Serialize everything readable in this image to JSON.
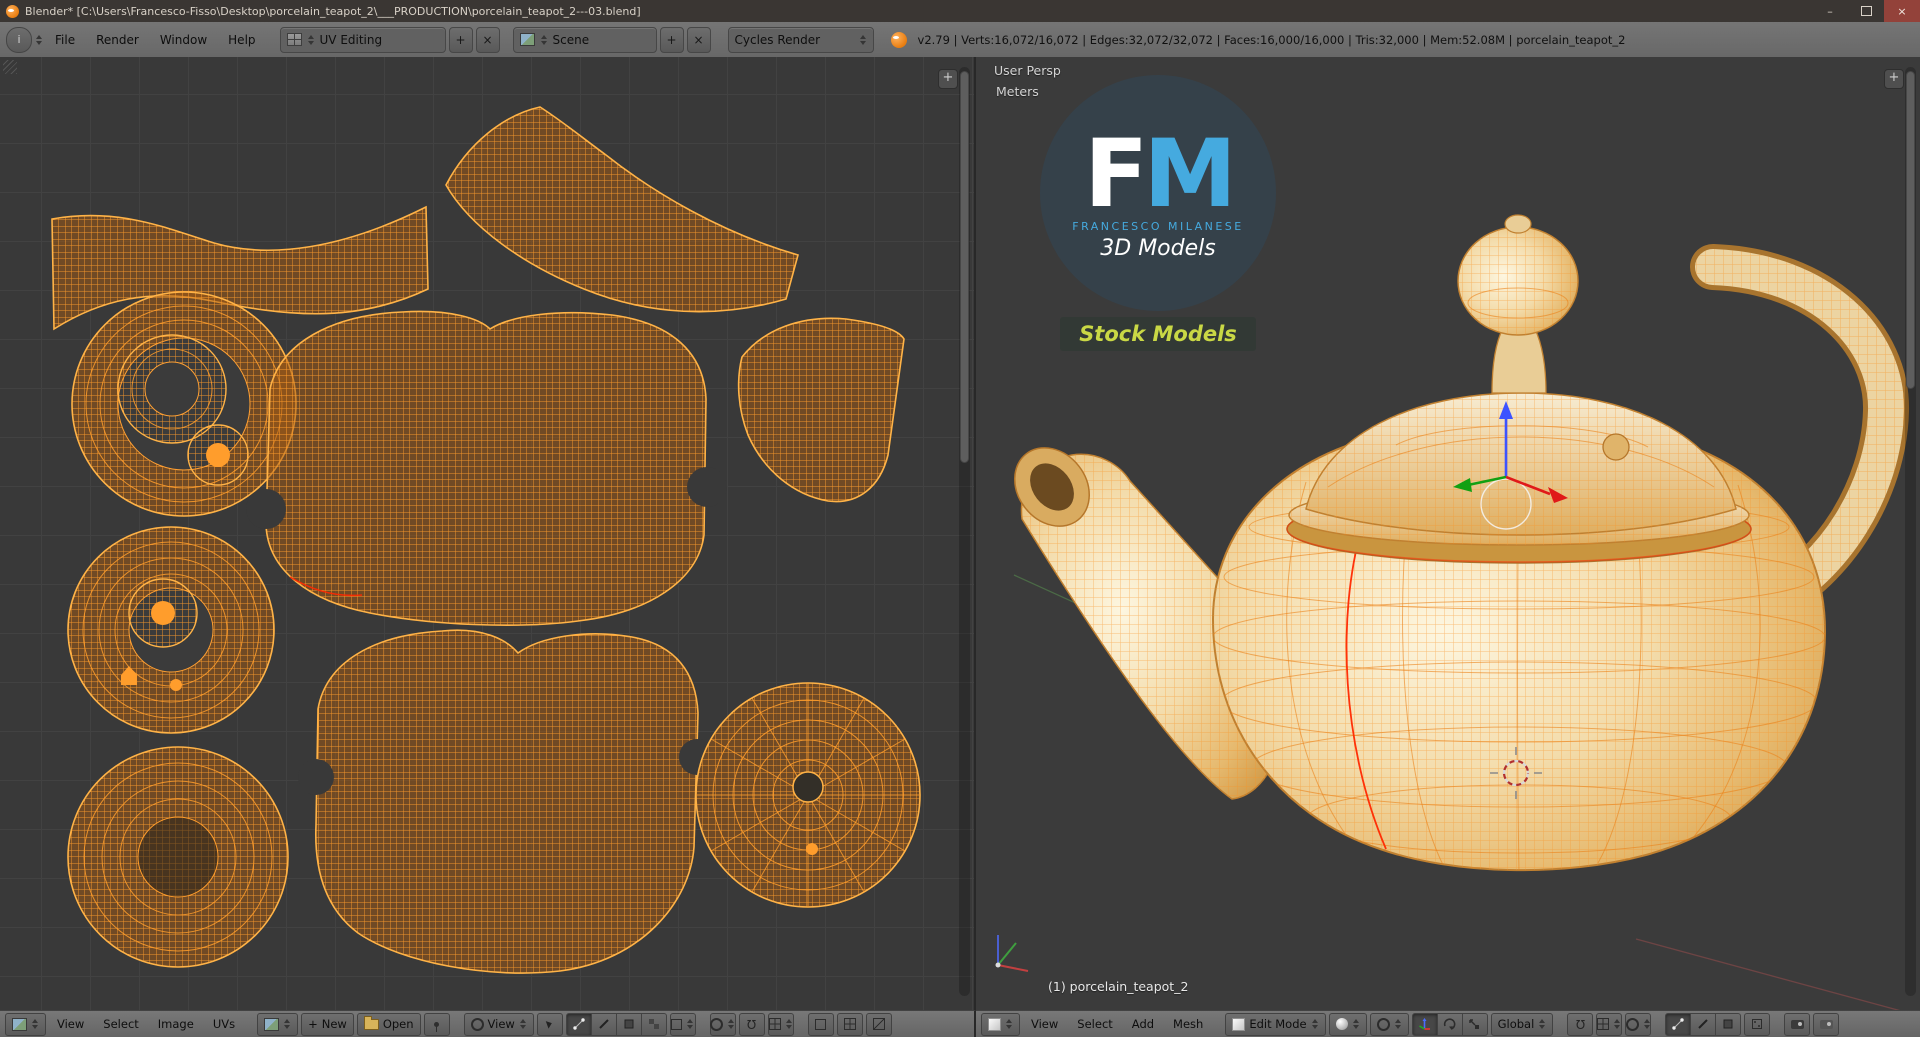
{
  "window": {
    "title": "Blender* [C:\\Users\\Francesco-Fisso\\Desktop\\porcelain_teapot_2\\___PRODUCTION\\porcelain_teapot_2---03.blend]",
    "controls": {
      "minimize": "–",
      "close": "×"
    }
  },
  "info_bar": {
    "menus": [
      "File",
      "Render",
      "Window",
      "Help"
    ],
    "layout": "UV Editing",
    "scene": "Scene",
    "engine": "Cycles Render",
    "stats": "v2.79 | Verts:16,072/16,072 | Edges:32,072/32,072 | Faces:16,000/16,000 | Tris:32,000 | Mem:52.08M | porcelain_teapot_2"
  },
  "viewport": {
    "view_name": "User Persp",
    "units": "Meters",
    "active_object": "(1) porcelain_teapot_2"
  },
  "watermark": {
    "f": "F",
    "m": "M",
    "author": "FRANCESCO MILANESE",
    "line2": "3D Models",
    "badge": "Stock Models"
  },
  "uv_header": {
    "menus": [
      "View",
      "Select",
      "Image",
      "UVs"
    ],
    "new": "New",
    "open": "Open",
    "plus": "+",
    "pivot": "View"
  },
  "v3d_header": {
    "menus": [
      "View",
      "Select",
      "Add",
      "Mesh"
    ],
    "mode": "Edit Mode",
    "orientation": "Global"
  },
  "colors": {
    "accent_orange": "#ff9d2c",
    "selection_red": "#ff2800",
    "watermark_blue": "#45aadf",
    "badge_green": "#c9d845",
    "header_gray": "#6e6e6e"
  }
}
